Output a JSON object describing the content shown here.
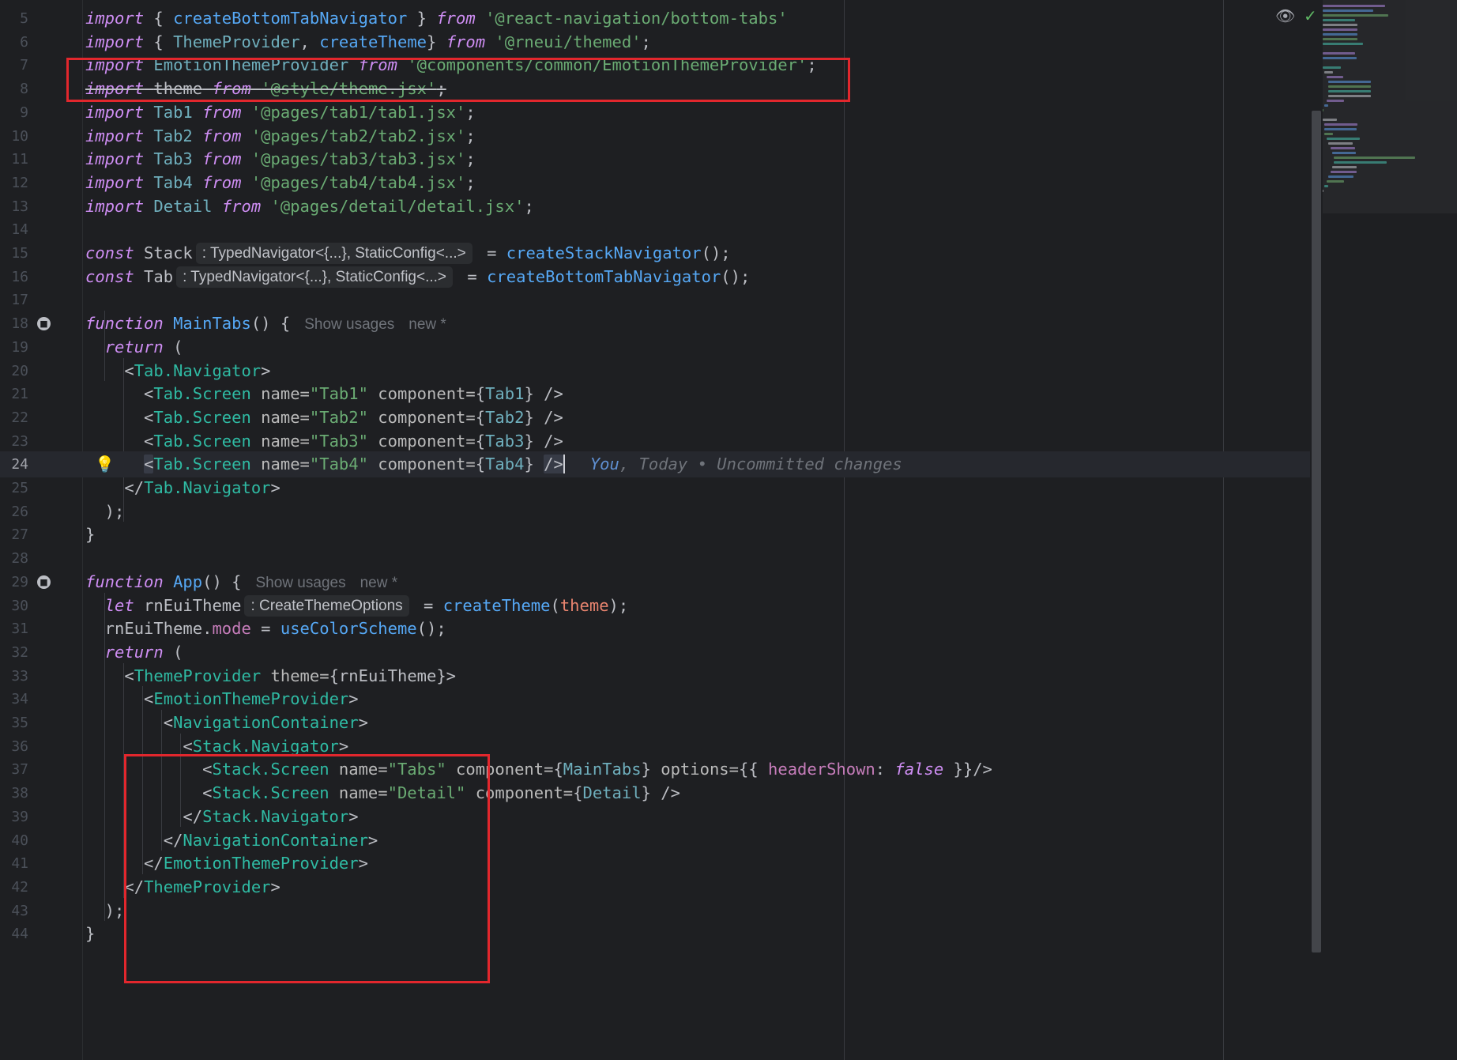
{
  "editor": {
    "current_line": 24,
    "blame": {
      "author": "You",
      "date": "Today",
      "message": "Uncommitted changes"
    },
    "lens": {
      "show_usages": "Show usages",
      "new": "new *"
    },
    "inlay": {
      "typed_navigator": ": TypedNavigator<{...}, StaticConfig<...>",
      "create_theme_options": ": CreateThemeOptions"
    },
    "colors": {
      "highlight_box": "#e2272d",
      "background": "#1e1f22"
    },
    "icons": [
      "reader-mode-toggle-icon",
      "no-problems-check-icon",
      "lightbulb-icon",
      "implementation-marker-icon"
    ]
  },
  "lines": [
    {
      "n": "5",
      "t": [
        "import",
        " { ",
        "createBottomTabNavigator",
        " } ",
        "from",
        " ",
        "'@react-navigation/bottom-tabs'"
      ]
    },
    {
      "n": "6",
      "t": [
        "import",
        " { ",
        "ThemeProvider",
        ", ",
        "createTheme",
        "} ",
        "from",
        " ",
        "'@rneui/themed'",
        ";"
      ]
    },
    {
      "n": "7",
      "t": [
        "import",
        " ",
        "EmotionThemeProvider",
        " ",
        "from",
        " ",
        "'@components/common/EmotionThemeProvider'",
        ";"
      ]
    },
    {
      "n": "8",
      "t": [
        "import",
        " ",
        "theme",
        " ",
        "from",
        " ",
        "'@style/theme.jsx'",
        ";"
      ]
    },
    {
      "n": "9",
      "t": [
        "import",
        " ",
        "Tab1",
        " ",
        "from",
        " ",
        "'@pages/tab1/tab1.jsx'",
        ";"
      ]
    },
    {
      "n": "10",
      "t": [
        "import",
        " ",
        "Tab2",
        " ",
        "from",
        " ",
        "'@pages/tab2/tab2.jsx'",
        ";"
      ]
    },
    {
      "n": "11",
      "t": [
        "import",
        " ",
        "Tab3",
        " ",
        "from",
        " ",
        "'@pages/tab3/tab3.jsx'",
        ";"
      ]
    },
    {
      "n": "12",
      "t": [
        "import",
        " ",
        "Tab4",
        " ",
        "from",
        " ",
        "'@pages/tab4/tab4.jsx'",
        ";"
      ]
    },
    {
      "n": "13",
      "t": [
        "import",
        " ",
        "Detail",
        " ",
        "from",
        " ",
        "'@pages/detail/detail.jsx'",
        ";"
      ]
    },
    {
      "n": "14",
      "t": []
    },
    {
      "n": "15",
      "t": [
        "const",
        " Stack",
        "",
        " = ",
        "createStackNavigator",
        "();"
      ]
    },
    {
      "n": "16",
      "t": [
        "const",
        " Tab",
        "",
        " = ",
        "createBottomTabNavigator",
        "();"
      ]
    },
    {
      "n": "17",
      "t": []
    },
    {
      "n": "18",
      "t": [
        "function",
        " ",
        "MainTabs",
        "() {"
      ]
    },
    {
      "n": "19",
      "t": [
        "  ",
        "return",
        " ("
      ]
    },
    {
      "n": "20",
      "t": [
        "    <",
        "Tab.Navigator",
        ">"
      ]
    },
    {
      "n": "21",
      "t": [
        "      <",
        "Tab.Screen",
        " ",
        "name=",
        "\"Tab1\"",
        " ",
        "component=",
        "{",
        "Tab1",
        "} />"
      ]
    },
    {
      "n": "22",
      "t": [
        "      <",
        "Tab.Screen",
        " ",
        "name=",
        "\"Tab2\"",
        " ",
        "component=",
        "{",
        "Tab2",
        "} />"
      ]
    },
    {
      "n": "23",
      "t": [
        "      <",
        "Tab.Screen",
        " ",
        "name=",
        "\"Tab3\"",
        " ",
        "component=",
        "{",
        "Tab3",
        "} />"
      ]
    },
    {
      "n": "24",
      "t": [
        "      <",
        "Tab.Screen",
        " ",
        "name=",
        "\"Tab4\"",
        " ",
        "component=",
        "{",
        "Tab4",
        "} ",
        "/>"
      ]
    },
    {
      "n": "25",
      "t": [
        "    </",
        "Tab.Navigator",
        ">"
      ]
    },
    {
      "n": "26",
      "t": [
        "  );"
      ]
    },
    {
      "n": "27",
      "t": [
        "}"
      ]
    },
    {
      "n": "28",
      "t": []
    },
    {
      "n": "29",
      "t": [
        "function",
        " ",
        "App",
        "() {"
      ]
    },
    {
      "n": "30",
      "t": [
        "  ",
        "let",
        " rnEuiTheme",
        "",
        " = ",
        "createTheme",
        "(",
        "theme",
        ");"
      ]
    },
    {
      "n": "31",
      "t": [
        "  rnEuiTheme.",
        "mode",
        " = ",
        "useColorScheme",
        "();"
      ]
    },
    {
      "n": "32",
      "t": [
        "  ",
        "return",
        " ("
      ]
    },
    {
      "n": "33",
      "t": [
        "    <",
        "ThemeProvider",
        " ",
        "theme=",
        "{rnEuiTheme}>"
      ]
    },
    {
      "n": "34",
      "t": [
        "      <",
        "EmotionThemeProvider",
        ">"
      ]
    },
    {
      "n": "35",
      "t": [
        "        <",
        "NavigationContainer",
        ">"
      ]
    },
    {
      "n": "36",
      "t": [
        "          <",
        "Stack.Navigator",
        ">"
      ]
    },
    {
      "n": "37",
      "t": [
        "            <",
        "Stack.Screen",
        " ",
        "name=",
        "\"Tabs\"",
        " ",
        "component=",
        "{",
        "MainTabs",
        "} ",
        "options=",
        "{{ ",
        "headerShown",
        ": ",
        "false",
        " }}/>"
      ]
    },
    {
      "n": "38",
      "t": [
        "            <",
        "Stack.Screen",
        " ",
        "name=",
        "\"Detail\"",
        " ",
        "component=",
        "{",
        "Detail",
        "} />"
      ]
    },
    {
      "n": "39",
      "t": [
        "          </",
        "Stack.Navigator",
        ">"
      ]
    },
    {
      "n": "40",
      "t": [
        "        </",
        "NavigationContainer",
        ">"
      ]
    },
    {
      "n": "41",
      "t": [
        "      </",
        "EmotionThemeProvider",
        ">"
      ]
    },
    {
      "n": "42",
      "t": [
        "    </",
        "ThemeProvider",
        ">"
      ]
    },
    {
      "n": "43",
      "t": [
        "  );"
      ]
    },
    {
      "n": "44",
      "t": [
        "}"
      ]
    }
  ]
}
